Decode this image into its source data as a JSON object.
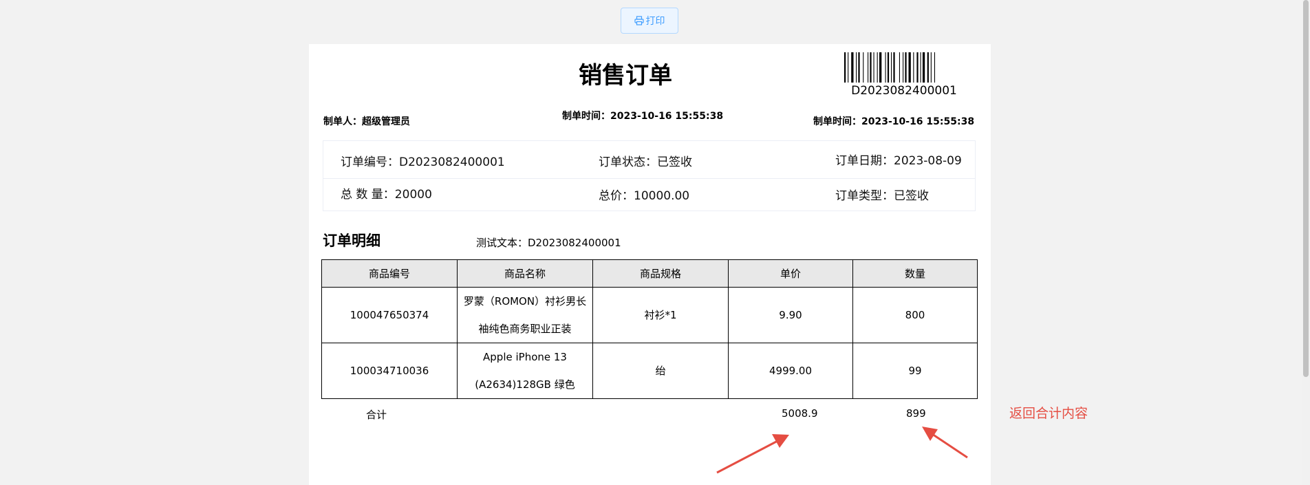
{
  "toolbar": {
    "print_label": "打印",
    "print_icon": "printer-icon",
    "accent": "#409eff"
  },
  "order": {
    "title": "销售订单",
    "barcode_text": "D2023082400001",
    "maker": "制单人：超级管理员",
    "make_time_center": "制单时间：2023-10-16 15:55:38",
    "make_time_right": "制单时间：2023-10-16 15:55:38",
    "info": {
      "order_no": "订单编号：D2023082400001",
      "status": "订单状态：已签收",
      "date": "订单日期：2023-08-09",
      "total_qty": "总 数 量：20000",
      "total_price": "总价：10000.00",
      "type": "订单类型：已签收"
    }
  },
  "detail": {
    "title": "订单明细",
    "test_text": "测试文本：D2023082400001",
    "columns": [
      "商品编号",
      "商品名称",
      "商品规格",
      "单价",
      "数量"
    ],
    "rows": [
      [
        "100047650374",
        "罗蒙（ROMON）衬衫男长袖纯色商务职业正装",
        "衬衫*1",
        "9.90",
        "800"
      ],
      [
        "100034710036",
        "Apple iPhone 13 (A2634)128GB 绿色",
        "绐",
        "4999.00",
        "99"
      ]
    ],
    "total_label": "合计",
    "total_price": "5008.9",
    "total_qty": "899"
  },
  "annotation": {
    "text": "返回合计内容",
    "color": "#e54d42"
  }
}
